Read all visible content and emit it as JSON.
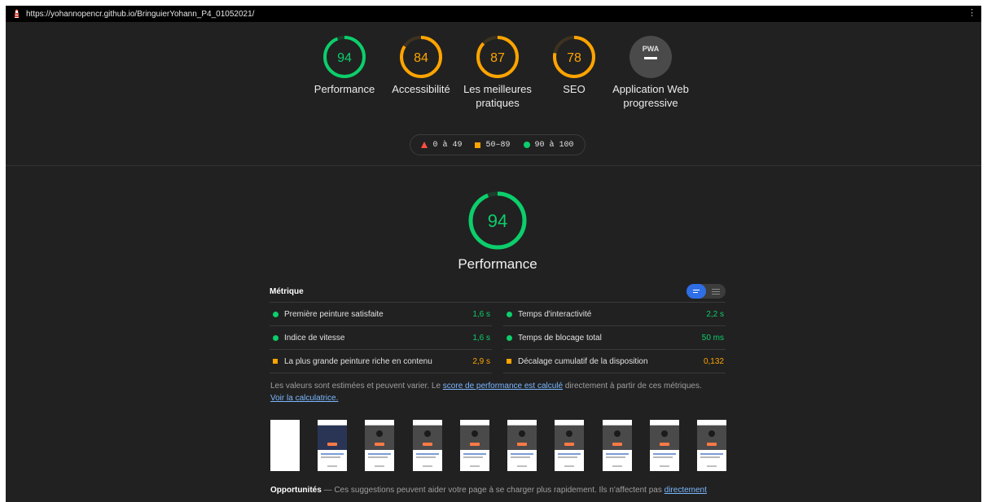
{
  "address_bar": {
    "url": "https://yohannopencr.github.io/BringuierYohann_P4_01052021/"
  },
  "categories": [
    {
      "label": "Performance",
      "score": "94",
      "value": 94,
      "color": "#0cce6b"
    },
    {
      "label": "Accessibilité",
      "score": "84",
      "value": 84,
      "color": "#ffa400"
    },
    {
      "label": "Les meilleures pratiques",
      "score": "87",
      "value": 87,
      "color": "#ffa400"
    },
    {
      "label": "SEO",
      "score": "78",
      "value": 78,
      "color": "#ffa400"
    },
    {
      "label": "Application Web progressive",
      "badge": "PWA"
    }
  ],
  "legend": {
    "fail": "0 à 49",
    "average": "50–89",
    "pass": "90 à 100"
  },
  "performance": {
    "score": "94",
    "value": 94,
    "title": "Performance",
    "color": "#0cce6b"
  },
  "metrics": {
    "heading": "Métrique",
    "left": [
      {
        "name": "Première peinture satisfaite",
        "value": "1,6 s",
        "status": "pass"
      },
      {
        "name": "Indice de vitesse",
        "value": "1,6 s",
        "status": "pass"
      },
      {
        "name": "La plus grande peinture riche en contenu",
        "value": "2,9 s",
        "status": "average"
      }
    ],
    "right": [
      {
        "name": "Temps d'interactivité",
        "value": "2,2 s",
        "status": "pass"
      },
      {
        "name": "Temps de blocage total",
        "value": "50 ms",
        "status": "pass"
      },
      {
        "name": "Décalage cumulatif de la disposition",
        "value": "0,132",
        "status": "average"
      }
    ]
  },
  "note": {
    "text_before": "Les valeurs sont estimées et peuvent varier. Le ",
    "link1": "score de performance est calculé",
    "text_after": " directement à partir de ces métriques.",
    "link2": "Voir la calculatrice."
  },
  "opportunities": {
    "title": "Opportunités",
    "text": " — Ces suggestions peuvent aider votre page à se charger plus rapidement. Ils n'affectent pas ",
    "link": "directement"
  },
  "colors": {
    "pass": "#0cce6b",
    "average": "#ffa400",
    "fail": "#ff4e42",
    "background": "#212121"
  }
}
